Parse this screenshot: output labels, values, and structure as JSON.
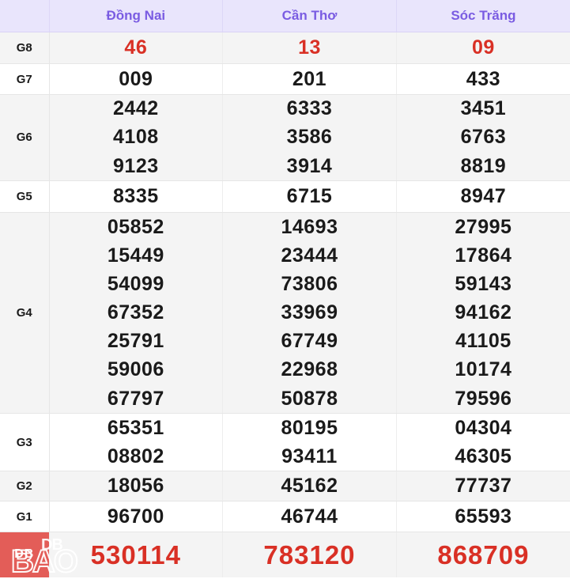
{
  "table": {
    "corner_label": "",
    "provinces": [
      "Đồng Nai",
      "Cần Thơ",
      "Sóc Trăng"
    ],
    "rows": [
      {
        "label": "G8",
        "style": "red",
        "values": [
          [
            "46"
          ],
          [
            "13"
          ],
          [
            "09"
          ]
        ]
      },
      {
        "label": "G7",
        "style": "normal",
        "values": [
          [
            "009"
          ],
          [
            "201"
          ],
          [
            "433"
          ]
        ]
      },
      {
        "label": "G6",
        "style": "normal",
        "values": [
          [
            "2442",
            "4108",
            "9123"
          ],
          [
            "6333",
            "3586",
            "3914"
          ],
          [
            "3451",
            "6763",
            "8819"
          ]
        ]
      },
      {
        "label": "G5",
        "style": "normal",
        "values": [
          [
            "8335"
          ],
          [
            "6715"
          ],
          [
            "8947"
          ]
        ]
      },
      {
        "label": "G4",
        "style": "normal",
        "values": [
          [
            "05852",
            "15449",
            "54099",
            "67352",
            "25791",
            "59006",
            "67797"
          ],
          [
            "14693",
            "23444",
            "73806",
            "33969",
            "67749",
            "22968",
            "50878"
          ],
          [
            "27995",
            "17864",
            "59143",
            "94162",
            "41105",
            "10174",
            "79596"
          ]
        ]
      },
      {
        "label": "G3",
        "style": "normal",
        "values": [
          [
            "65351",
            "08802"
          ],
          [
            "80195",
            "93411"
          ],
          [
            "04304",
            "46305"
          ]
        ]
      },
      {
        "label": "G2",
        "style": "normal",
        "values": [
          [
            "18056"
          ],
          [
            "45162"
          ],
          [
            "77737"
          ]
        ]
      },
      {
        "label": "G1",
        "style": "normal",
        "values": [
          [
            "96700"
          ],
          [
            "46744"
          ],
          [
            "65593"
          ]
        ]
      },
      {
        "label": "DB",
        "style": "special",
        "values": [
          [
            "530114"
          ],
          [
            "783120"
          ],
          [
            "868709"
          ]
        ]
      }
    ]
  },
  "watermark": {
    "line1": "DB",
    "line2": "BAO"
  },
  "colors": {
    "header_bg": "#e9e5fc",
    "header_text": "#7a5ce2",
    "stripe_bg": "#f4f4f4",
    "prize_red": "#d93025",
    "db_label_bg": "#e35d58"
  }
}
